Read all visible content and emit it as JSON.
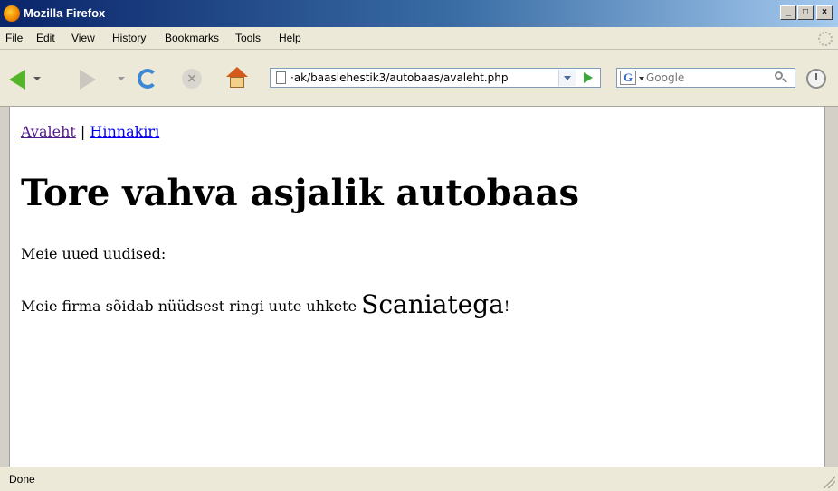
{
  "window": {
    "title": "Mozilla Firefox",
    "controls": {
      "minimize": "_",
      "maximize": "□",
      "close": "×"
    }
  },
  "menu": {
    "items": [
      "File",
      "Edit",
      "View",
      "History",
      "Bookmarks",
      "Tools",
      "Help"
    ]
  },
  "toolbar": {
    "icons": [
      "back-icon",
      "forward-icon",
      "reload-icon",
      "stop-icon",
      "home-icon",
      "go-icon",
      "search-engine-icon",
      "search-icon",
      "history-icon"
    ],
    "url": "·ak/baaslehestik3/autobaas/avaleht.php",
    "search_placeholder": "Google",
    "search_engine_letter": "G"
  },
  "page": {
    "nav": {
      "home_link": "Avaleht",
      "separator": "|",
      "prices_link": "Hinnakiri"
    },
    "heading": "Tore vahva asjalik autobaas",
    "news_intro": "Meie uued uudised:",
    "news_text_before": "Meie firma sõidab nüüdsest ringi uute uhkete",
    "news_highlight": "Scaniatega",
    "news_text_after": "!"
  },
  "status": {
    "text": "Done"
  },
  "colors": {
    "visited_link": "#551a8b",
    "unvisited_link": "#0000ee",
    "title_bar_start": "#0a246a",
    "title_bar_end": "#a6caf0"
  }
}
